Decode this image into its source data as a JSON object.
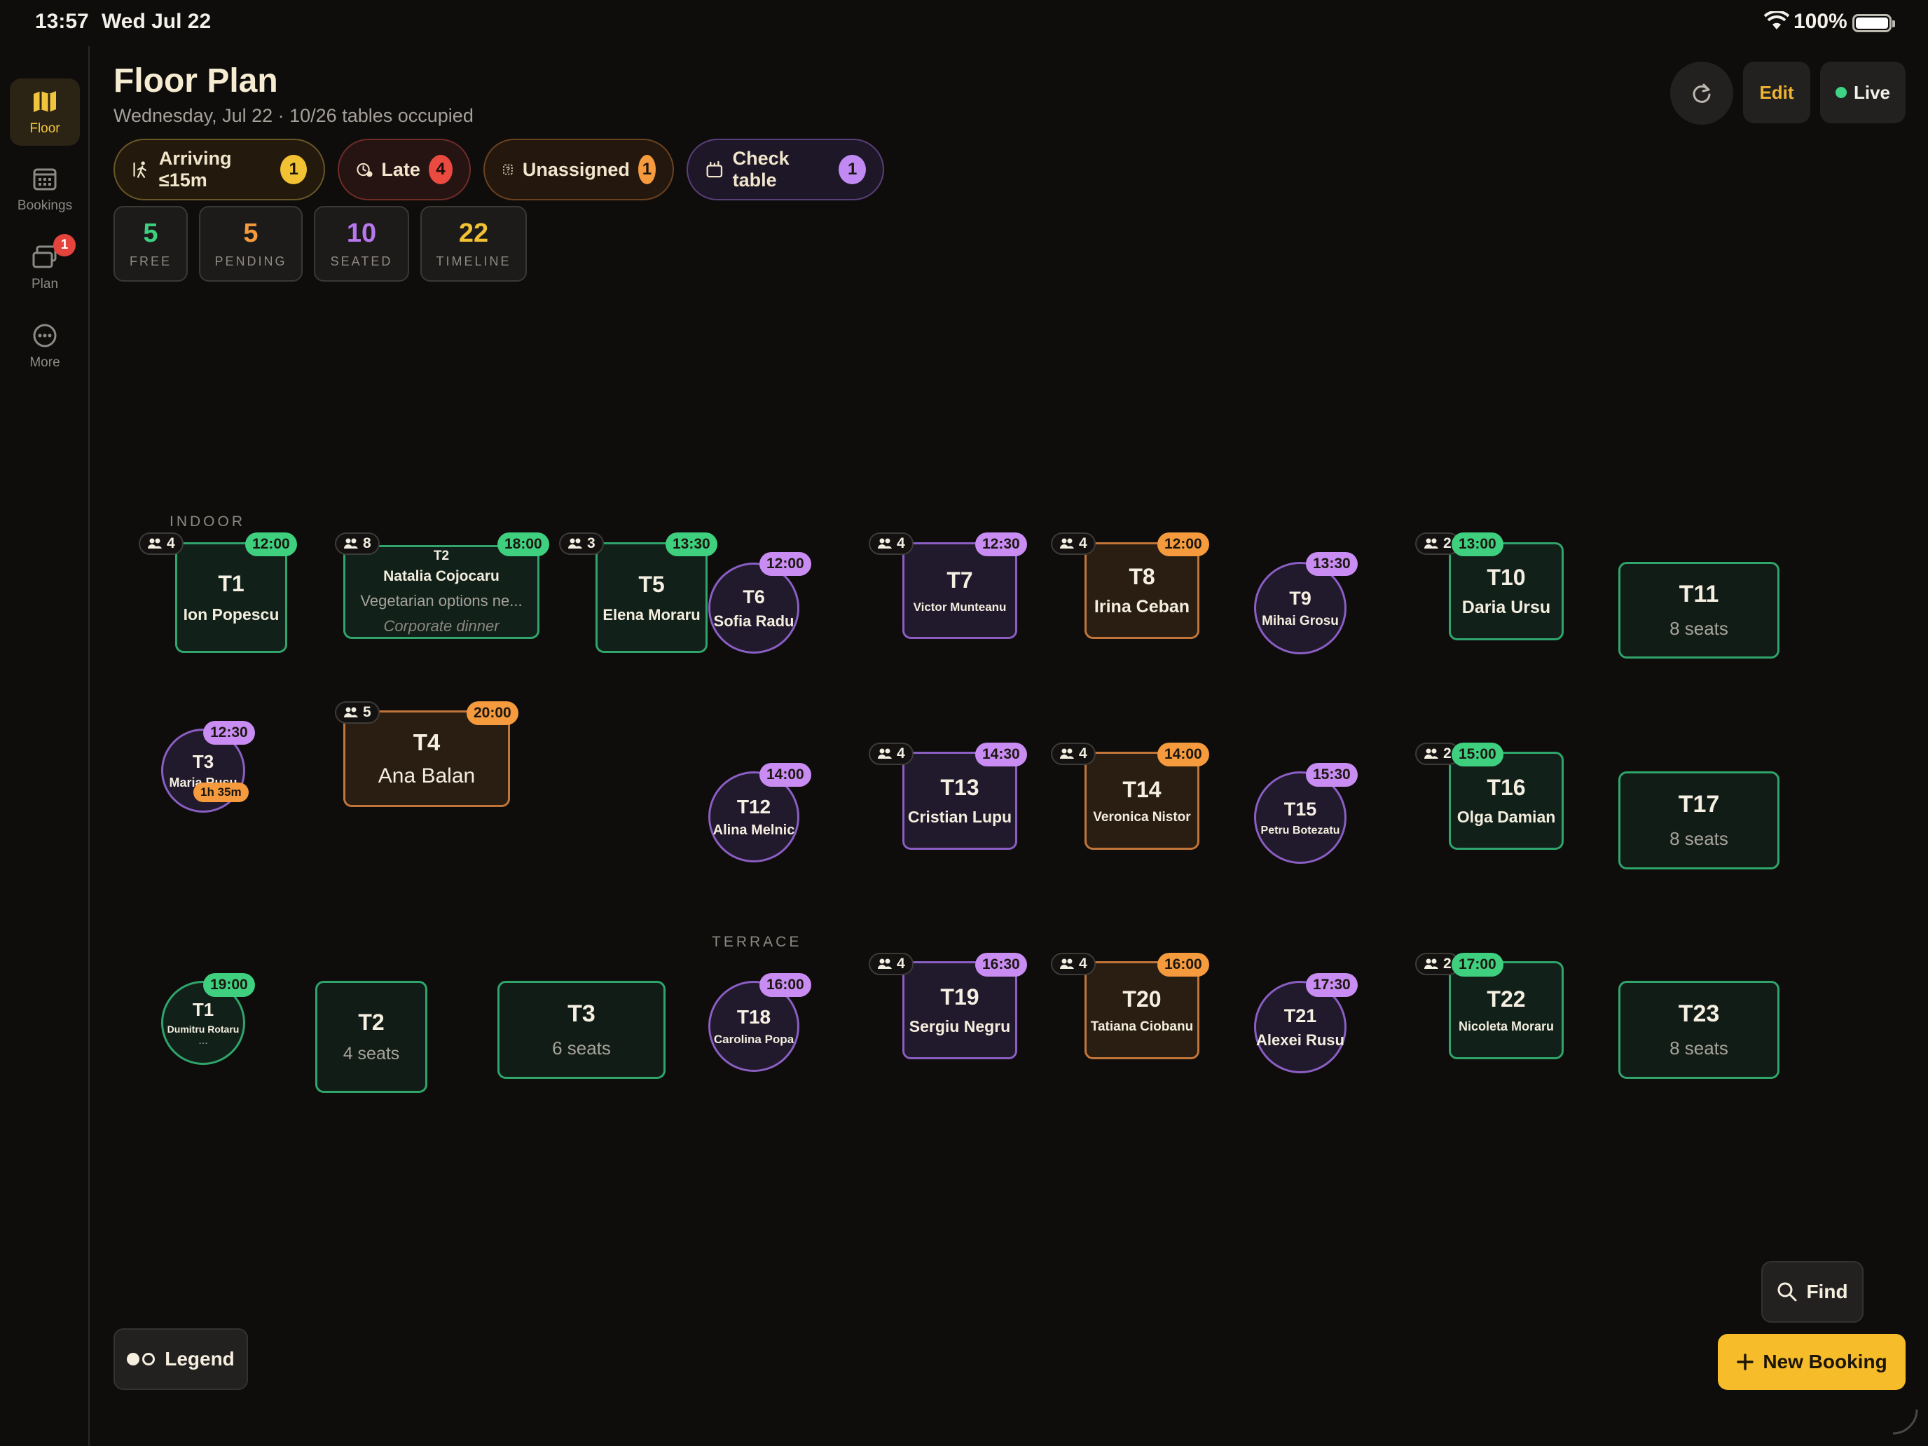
{
  "status_bar": {
    "time": "13:57",
    "date": "Wed Jul 22",
    "battery": "100%"
  },
  "sidebar": {
    "items": [
      {
        "label": "Floor",
        "icon": "map-icon",
        "active": true
      },
      {
        "label": "Bookings",
        "icon": "calendar-icon",
        "active": false
      },
      {
        "label": "Plan",
        "icon": "layers-icon",
        "active": false,
        "badge": "1"
      },
      {
        "label": "More",
        "icon": "more-icon",
        "active": false
      }
    ]
  },
  "header": {
    "title": "Floor Plan",
    "subtitle": "Wednesday, Jul 22 · 10/26 tables occupied",
    "edit_label": "Edit",
    "live_label": "Live"
  },
  "filters": [
    {
      "label": "Arriving ≤15m",
      "count": "1",
      "icon": "walking-icon",
      "color": "#f3c233"
    },
    {
      "label": "Late",
      "count": "4",
      "icon": "clock-alert-icon",
      "color": "#ea4a40"
    },
    {
      "label": "Unassigned",
      "count": "1",
      "icon": "unassigned-icon",
      "color": "#f59a3d"
    },
    {
      "label": "Check table",
      "count": "1",
      "icon": "receipt-icon",
      "color": "#c08af2"
    }
  ],
  "stats": [
    {
      "value": "5",
      "label": "FREE",
      "color": "#3fd07f"
    },
    {
      "value": "5",
      "label": "PENDING",
      "color": "#f59a3d"
    },
    {
      "value": "10",
      "label": "SEATED",
      "color": "#b777ee"
    },
    {
      "value": "22",
      "label": "TIMELINE",
      "color": "#f3c233"
    }
  ],
  "zones": {
    "indoor": "INDOOR",
    "terrace": "TERRACE"
  },
  "tables": {
    "t1": {
      "name": "T1",
      "guest": "Ion Popescu",
      "party": "4",
      "time": "12:00"
    },
    "t2": {
      "name": "T2",
      "guest": "Natalia Cojocaru",
      "note": "Vegetarian options ne...",
      "tag": "Corporate dinner",
      "party": "8",
      "time": "18:00"
    },
    "t5": {
      "name": "T5",
      "guest": "Elena Moraru",
      "party": "3",
      "time": "13:30"
    },
    "t6": {
      "name": "T6",
      "guest": "Sofia Radu",
      "time": "12:00"
    },
    "t7": {
      "name": "T7",
      "guest": "Victor Munteanu",
      "party": "4",
      "time": "12:30"
    },
    "t8": {
      "name": "T8",
      "guest": "Irina Ceban",
      "party": "4",
      "time": "12:00"
    },
    "t9": {
      "name": "T9",
      "guest": "Mihai Grosu",
      "time": "13:30"
    },
    "t10": {
      "name": "T10",
      "guest": "Daria Ursu",
      "party": "2",
      "time": "13:00"
    },
    "t11": {
      "name": "T11",
      "seats": "8 seats"
    },
    "t3": {
      "name": "T3",
      "guest": "Maria Rusu",
      "time": "12:30",
      "overdue": "1h 35m"
    },
    "t4": {
      "name": "T4",
      "guest": "Ana Balan",
      "party": "5",
      "time": "20:00"
    },
    "t12": {
      "name": "T12",
      "guest": "Alina Melnic",
      "time": "14:00"
    },
    "t13": {
      "name": "T13",
      "guest": "Cristian Lupu",
      "party": "4",
      "time": "14:30"
    },
    "t14": {
      "name": "T14",
      "guest": "Veronica Nistor",
      "party": "4",
      "time": "14:00"
    },
    "t15": {
      "name": "T15",
      "guest": "Petru Botezatu",
      "time": "15:30"
    },
    "t16": {
      "name": "T16",
      "guest": "Olga Damian",
      "party": "2",
      "time": "15:00"
    },
    "t17": {
      "name": "T17",
      "seats": "8 seats"
    },
    "tr1": {
      "name": "T1",
      "guest": "Dumitru Rotaru",
      "extra": "...",
      "time": "19:00"
    },
    "tr2": {
      "name": "T2",
      "seats": "4 seats"
    },
    "tr3": {
      "name": "T3",
      "seats": "6 seats"
    },
    "t18": {
      "name": "T18",
      "guest": "Carolina Popa",
      "time": "16:00"
    },
    "t19": {
      "name": "T19",
      "guest": "Sergiu Negru",
      "party": "4",
      "time": "16:30"
    },
    "t20": {
      "name": "T20",
      "guest": "Tatiana Ciobanu",
      "party": "4",
      "time": "16:00"
    },
    "t21": {
      "name": "T21",
      "guest": "Alexei Rusu",
      "time": "17:30"
    },
    "t22": {
      "name": "T22",
      "guest": "Nicoleta Moraru",
      "party": "2",
      "time": "17:00"
    },
    "t23": {
      "name": "T23",
      "seats": "8 seats"
    }
  },
  "bottom": {
    "legend_label": "Legend",
    "find_label": "Find",
    "new_booking_label": "New Booking"
  },
  "colors": {
    "free": "#3fd07f",
    "pending": "#f59a3d",
    "seated": "#b777ee",
    "accent": "#f6bc2a"
  }
}
